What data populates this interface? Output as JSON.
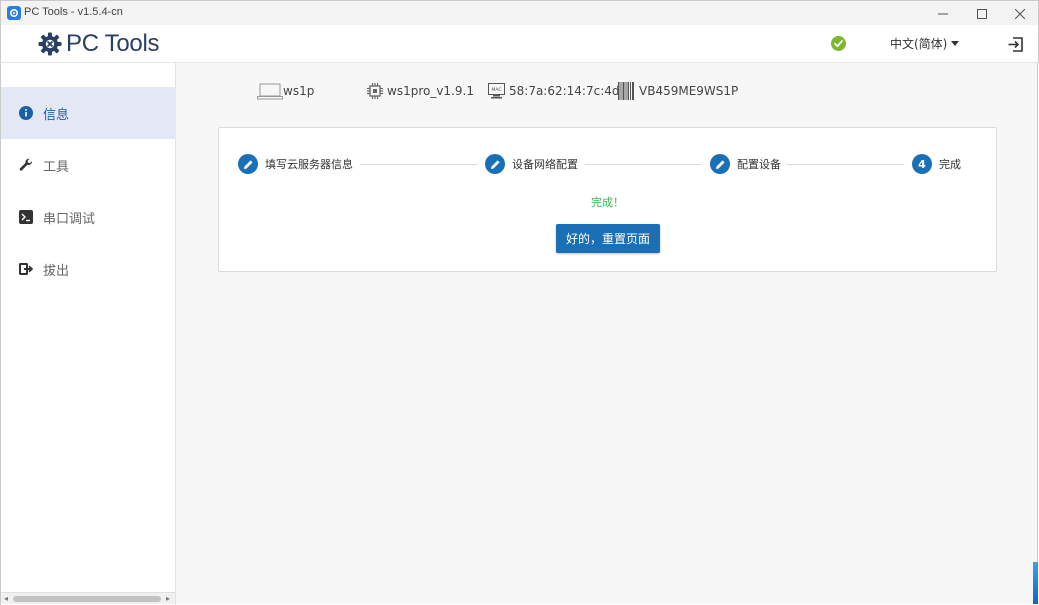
{
  "window": {
    "title": "PC Tools - v1.5.4-cn",
    "controls": [
      "minimize",
      "maximize",
      "close"
    ]
  },
  "header": {
    "brand": "PC Tools",
    "status_icon": "check-circle-icon",
    "status_color": "#7cb82f",
    "language": "中文(简体)",
    "logout_icon": "logout-icon"
  },
  "sidebar": {
    "items": [
      {
        "label": "信息",
        "icon": "info-icon",
        "active": true
      },
      {
        "label": "工具",
        "icon": "wrench-icon",
        "active": false
      },
      {
        "label": "串口调试",
        "icon": "terminal-icon",
        "active": false
      },
      {
        "label": "拔出",
        "icon": "sign-out-icon",
        "active": false
      }
    ]
  },
  "device": {
    "name": "ws1p",
    "firmware": "ws1pro_v1.9.1",
    "mac": "58:7a:62:14:7c:4d",
    "serial": "VB459ME9WS1P",
    "mac_icon_text": "MAC"
  },
  "wizard": {
    "steps": [
      {
        "label": "填写云服务器信息",
        "marker": "edit"
      },
      {
        "label": "设备网络配置",
        "marker": "edit"
      },
      {
        "label": "配置设备",
        "marker": "edit"
      },
      {
        "label": "完成",
        "marker": "4"
      }
    ],
    "result_text": "完成！",
    "reset_button": "好的，重置页面"
  },
  "colors": {
    "accent": "#1a6fb5",
    "sidebar_active_bg": "#e3e8f4",
    "success": "#39b54a"
  }
}
